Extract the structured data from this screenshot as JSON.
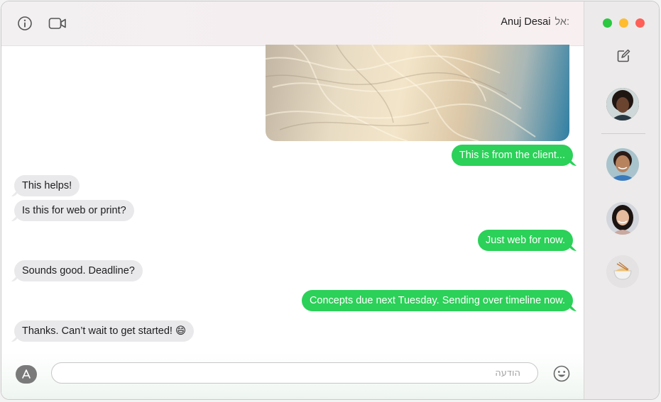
{
  "header": {
    "to_label": "אל:",
    "contact_name": "Anuj Desai"
  },
  "messages": [
    {
      "direction": "out",
      "text": "This is from the client..."
    },
    {
      "direction": "in",
      "text": "This helps!"
    },
    {
      "direction": "in",
      "text": "Is this for web or print?"
    },
    {
      "direction": "out",
      "text": "Just web for now."
    },
    {
      "direction": "in",
      "text": "Sounds good. Deadline?"
    },
    {
      "direction": "out",
      "text": "Concepts due next Tuesday. Sending over timeline now."
    },
    {
      "direction": "in",
      "text": "Thanks. Can’t wait to get started! 😄"
    }
  ],
  "composer": {
    "placeholder": "הודעה"
  },
  "colors": {
    "sent_bubble": "#2bd158",
    "received_bubble": "#e9e9eb",
    "traffic_green": "#2bc840",
    "traffic_yellow": "#febc2e",
    "traffic_red": "#ff5f57"
  }
}
